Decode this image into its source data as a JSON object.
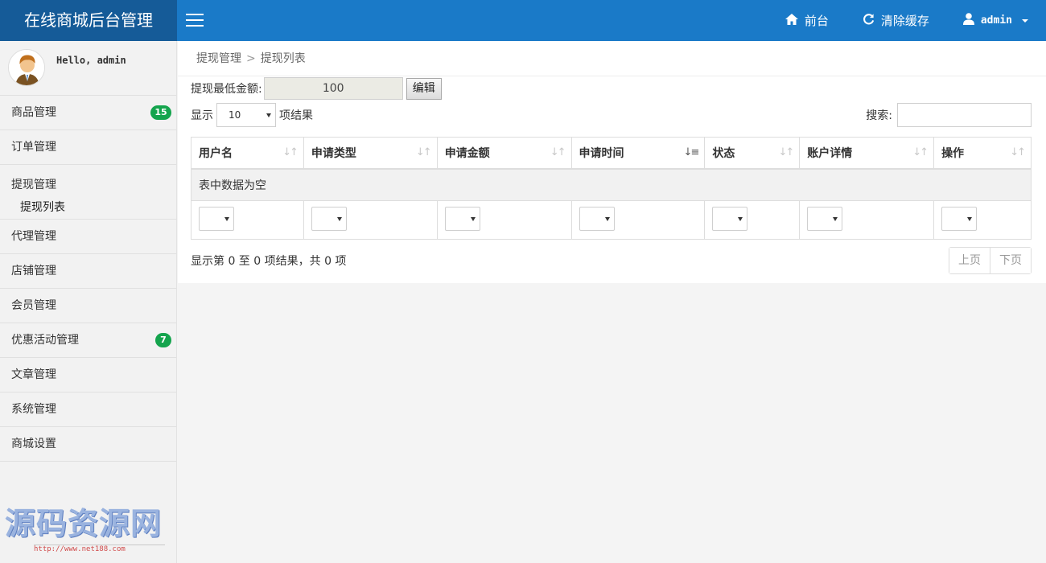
{
  "header": {
    "brand": "在线商城后台管理",
    "nav": {
      "frontend": "前台",
      "clear_cache": "清除缓存",
      "user": "admin"
    }
  },
  "sidebar": {
    "greeting": "Hello, admin",
    "items": [
      {
        "label": "商品管理",
        "badge": "15"
      },
      {
        "label": "订单管理"
      },
      {
        "label": "提现管理",
        "children": [
          "提现列表"
        ]
      },
      {
        "label": "代理管理"
      },
      {
        "label": "店铺管理"
      },
      {
        "label": "会员管理"
      },
      {
        "label": "优惠活动管理",
        "badge": "7"
      },
      {
        "label": "文章管理"
      },
      {
        "label": "系统管理"
      },
      {
        "label": "商城设置"
      }
    ],
    "watermark": {
      "title": "源码资源网",
      "url": "http://www.net188.com"
    }
  },
  "breadcrumb": {
    "parent": "提现管理",
    "current": "提现列表"
  },
  "min_amount": {
    "label": "提现最低金额:",
    "value": "100",
    "edit_label": "编辑"
  },
  "length": {
    "prefix": "显示",
    "value": "10",
    "suffix": "项结果"
  },
  "search": {
    "label": "搜索:"
  },
  "table": {
    "columns": [
      "用户名",
      "申请类型",
      "申请金额",
      "申请时间",
      "状态",
      "账户详情",
      "操作"
    ],
    "empty_text": "表中数据为空"
  },
  "info": "显示第 0 至 0 项结果，共 0 项",
  "pager": {
    "prev": "上页",
    "next": "下页"
  },
  "colors": {
    "header": "#1a7ac8",
    "brand_bg": "#155b98",
    "badge": "#14a44d"
  }
}
